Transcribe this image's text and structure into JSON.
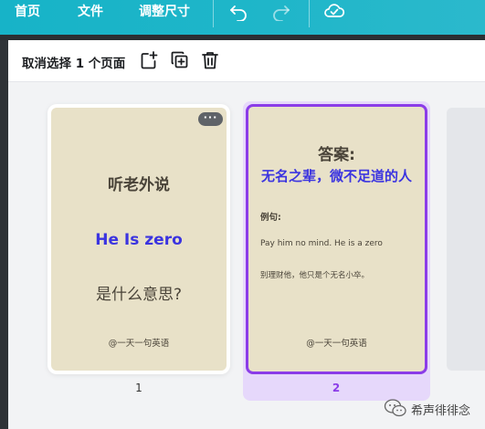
{
  "topbar": {
    "home": "首页",
    "file": "文件",
    "resize": "调整尺寸",
    "icons": [
      "undo-icon",
      "redo-icon",
      "cloud-saved-icon"
    ]
  },
  "toolbar": {
    "deselect_label": "取消选择 1 个页面",
    "icons": [
      "add-page-icon",
      "duplicate-page-icon",
      "delete-page-icon"
    ]
  },
  "pages": [
    {
      "number": "1",
      "title": "听老外说",
      "phrase": "He Is zero",
      "question": "是什么意思?",
      "signature": "@一天一句英语",
      "more_label": "···"
    },
    {
      "number": "2",
      "answer_label": "答案:",
      "meaning": "无名之辈，微不足道的人",
      "example_label": "例句:",
      "example_en": "Pay him no mind. He is a zero",
      "example_cn": "别理财他，他只是个无名小卒。",
      "signature": "@一天一句英语",
      "selected": true
    }
  ],
  "watermark": "希声徘徘念",
  "colors": {
    "topbar": "#1fb6c9",
    "card_bg": "#e8e1c8",
    "selection": "#8b3ce8",
    "selection_bg": "#e6d8fb",
    "highlight_text": "#3b34e0"
  }
}
